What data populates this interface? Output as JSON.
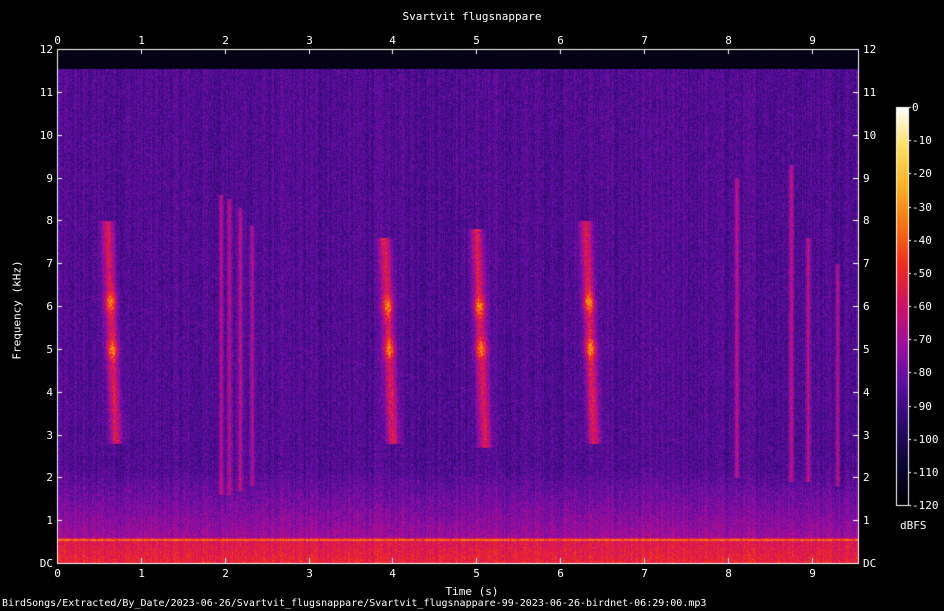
{
  "chart_data": {
    "type": "heatmap",
    "title": "Svartvit flugsnappare",
    "xlabel": "Time (s)",
    "ylabel": "Frequency (kHz)",
    "xlim": [
      0,
      9.55
    ],
    "ylim": [
      0,
      12
    ],
    "x_ticks": [
      "0",
      "1",
      "2",
      "3",
      "4",
      "5",
      "6",
      "7",
      "8",
      "9"
    ],
    "y_ticks": [
      "DC",
      "1",
      "2",
      "3",
      "4",
      "5",
      "6",
      "7",
      "8",
      "9",
      "10",
      "11",
      "12"
    ],
    "colorbar": {
      "label": "dBFS",
      "range": [
        -120,
        0
      ],
      "ticks": [
        "0",
        "-10",
        "-20",
        "-30",
        "-40",
        "-50",
        "-60",
        "-70",
        "-80",
        "-90",
        "-100",
        "-110",
        "-120"
      ],
      "colormap": [
        "#000000",
        "#0a0630",
        "#2a0a6a",
        "#5a0ea0",
        "#9a0ea0",
        "#d0106a",
        "#f02a20",
        "#f87010",
        "#fcb020",
        "#fde060",
        "#ffffff"
      ]
    },
    "features": [
      {
        "name": "call",
        "time": 0.7,
        "freq_low": 2.8,
        "freq_high": 8.0,
        "peaks": [
          5.0,
          6.1
        ]
      },
      {
        "name": "trill",
        "time": 1.95,
        "freq_low": 1.6,
        "freq_high": 8.6
      },
      {
        "name": "trill",
        "time": 2.05,
        "freq_low": 1.6,
        "freq_high": 8.5
      },
      {
        "name": "trill",
        "time": 2.18,
        "freq_low": 1.7,
        "freq_high": 8.3
      },
      {
        "name": "trill",
        "time": 2.32,
        "freq_low": 1.8,
        "freq_high": 7.9
      },
      {
        "name": "call",
        "time": 4.0,
        "freq_low": 2.8,
        "freq_high": 7.6,
        "peaks": [
          5.0,
          6.0
        ]
      },
      {
        "name": "call",
        "time": 5.1,
        "freq_low": 2.7,
        "freq_high": 7.8,
        "peaks": [
          5.0,
          6.0
        ]
      },
      {
        "name": "call",
        "time": 6.4,
        "freq_low": 2.8,
        "freq_high": 8.0,
        "peaks": [
          5.0,
          6.1
        ]
      },
      {
        "name": "chirp",
        "time": 8.1,
        "freq_low": 2.0,
        "freq_high": 9.0
      },
      {
        "name": "trill",
        "time": 8.75,
        "freq_low": 1.9,
        "freq_high": 9.3
      },
      {
        "name": "trill",
        "time": 8.95,
        "freq_low": 1.9,
        "freq_high": 7.6
      },
      {
        "name": "trill",
        "time": 9.3,
        "freq_low": 1.8,
        "freq_high": 7.0
      }
    ]
  },
  "footer_text": "BirdSongs/Extracted/By_Date/2023-06-26/Svartvit_flugsnappare/Svartvit_flugsnappare-99-2023-06-26-birdnet-06:29:00.mp3"
}
